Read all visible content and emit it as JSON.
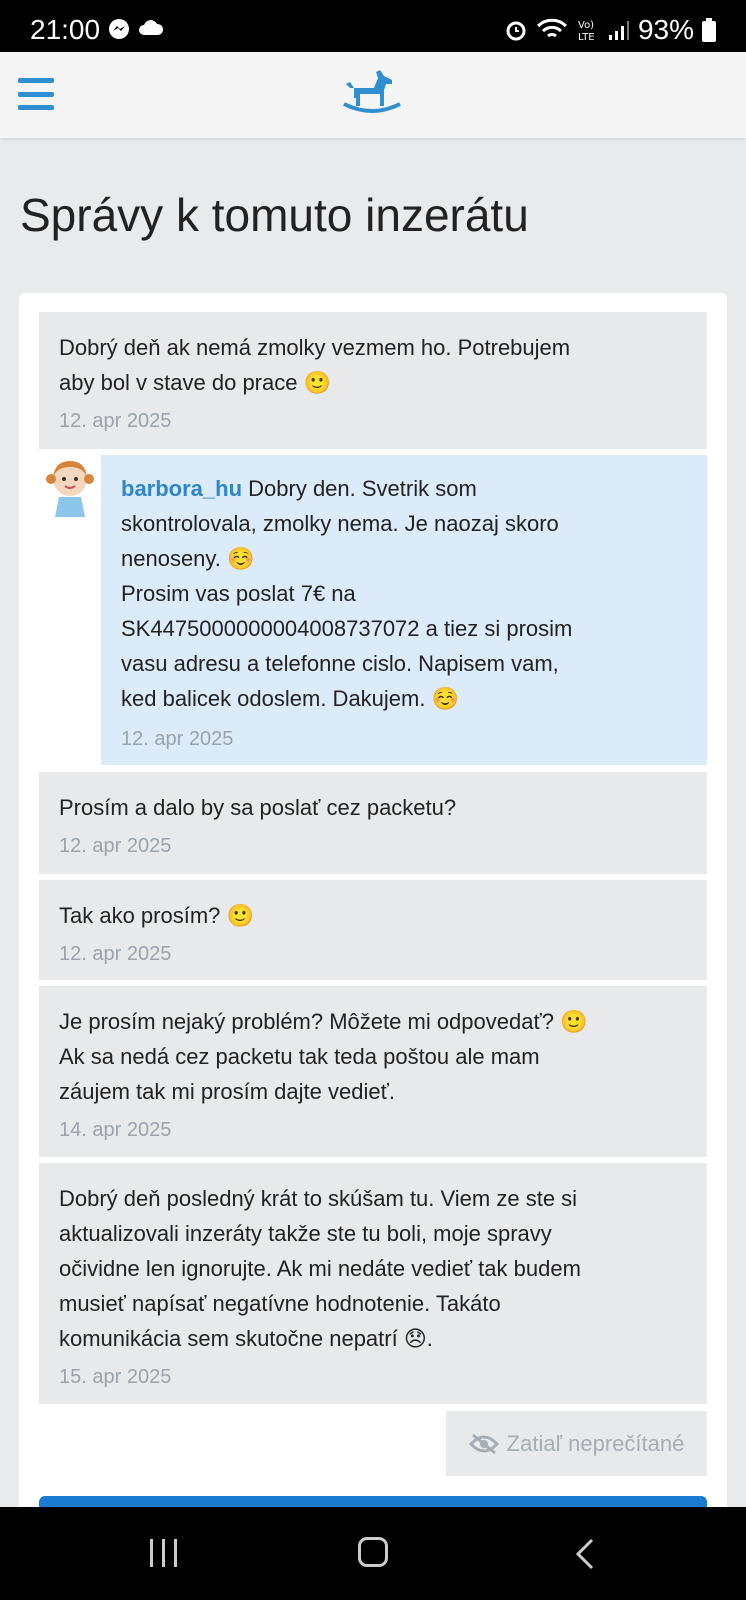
{
  "status_bar": {
    "time": "21:00",
    "battery": "93%",
    "icons": [
      "messenger-icon",
      "cloud-icon",
      "alarm-icon",
      "wifi-icon",
      "volte-icon",
      "signal-icon",
      "battery-icon"
    ]
  },
  "appbar": {
    "menu_icon": "hamburger-menu-icon",
    "logo": "rocking-horse-logo"
  },
  "page": {
    "title": "Správy k tomuto inzerátu"
  },
  "messages": [
    {
      "text": "Dobrý deň ak nemá zmolky vezmem ho. Potrebujem\naby bol v stave do prace 🙂",
      "date": "12. apr 2025"
    },
    {
      "user": "barbora_hu",
      "text": " Dobry den. Svetrik som\nskontrolovala, zmolky nema. Je naozaj skoro\nnenoseny. ☺️\nProsim vas poslat 7€ na\nSK4475000000004008737072 a tiez si prosim\nvasu adresu a telefonne cislo. Napisem vam,\nked balicek odoslem. Dakujem. ☺️",
      "date": "12. apr 2025"
    },
    {
      "text": "Prosím a dalo by sa poslať cez packetu?",
      "date": "12. apr 2025"
    },
    {
      "text": "Tak ako prosím? 🙂",
      "date": "12. apr 2025"
    },
    {
      "text": "Je prosím nejaký problém? Môžete mi odpovedať? 🙂\nAk sa nedá cez packetu tak teda poštou ale mam\nzáujem tak mi prosím dajte vedieť.",
      "date": "14. apr 2025"
    },
    {
      "text": "Dobrý deň posledný krát to skúšam tu. Viem ze ste si\naktualizovali inzeráty takže ste tu boli, moje spravy\nočividne len ignorujte. Ak mi nedáte vedieť tak budem\nmusieť napísať negatívne hodnotenie. Takáto\nkomunikácia sem skutočne nepatrí 😞.",
      "date": "15. apr 2025"
    }
  ],
  "unread": {
    "label": "Zatiaľ neprečítané",
    "icon": "eye-slash-icon"
  },
  "colors": {
    "accent": "#2f8fd0",
    "username": "#2e86c9",
    "reply_bg": "#dcebf9",
    "message_bg": "#e8e9eb",
    "button": "#1a7ad0"
  }
}
